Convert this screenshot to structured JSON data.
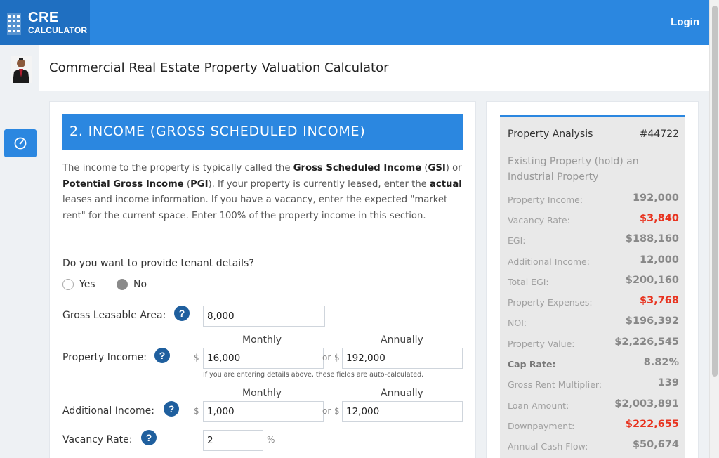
{
  "brand": {
    "line1": "CRE",
    "line2": "CALCULATOR"
  },
  "nav": {
    "login": "Login"
  },
  "page": {
    "title": "Commercial Real Estate Property Valuation Calculator"
  },
  "section": {
    "title": "2. INCOME (GROSS SCHEDULED INCOME)",
    "intro": {
      "p1": "The income to the property is typically called the ",
      "b1": "Gross Scheduled Income",
      "p2": " (",
      "b2": "GSI",
      "p3": ") or ",
      "b3": "Potential Gross Income",
      "p4": " (",
      "b4": "PGI",
      "p5": "). If your property is currently leased, enter the ",
      "b5": "actual",
      "p6": " leases and income information. If you have a vacancy, enter the expected \"market rent\" for the current space. Enter 100% of the property income in this section."
    }
  },
  "tenant": {
    "question": "Do you want to provide tenant details?",
    "yes": "Yes",
    "no": "No",
    "selected": "No"
  },
  "form": {
    "gla": {
      "label": "Gross Leasable Area:",
      "value": "8,000"
    },
    "monthly_header": "Monthly",
    "annually_header": "Annually",
    "currency": "$",
    "or": "or",
    "property_income": {
      "label": "Property Income:",
      "monthly": "16,000",
      "annually": "192,000"
    },
    "note": "If you are entering details above, these fields are auto-calculated.",
    "additional_income": {
      "label": "Additional Income:",
      "monthly": "1,000",
      "annually": "12,000"
    },
    "vacancy": {
      "label": "Vacancy Rate:",
      "value": "2",
      "unit": "%"
    }
  },
  "analysis": {
    "title": "Property Analysis",
    "id": "#44722",
    "description": "Existing Property (hold) an Industrial Property",
    "rows": [
      {
        "label": "Property Income:",
        "value": "192,000"
      },
      {
        "label": "Vacancy Rate:",
        "value": "$3,840"
      },
      {
        "label": "EGI:",
        "value": "$188,160"
      },
      {
        "label": "Additional Income:",
        "value": "12,000"
      },
      {
        "label": "Total EGI:",
        "value": "$200,160"
      },
      {
        "label": "Property Expenses:",
        "value": "$3,768"
      },
      {
        "label": "NOI:",
        "value": "$196,392"
      },
      {
        "label": "Property Value:",
        "value": "$2,226,545"
      },
      {
        "label": "Cap Rate:",
        "value": "8.82%"
      },
      {
        "label": "Gross Rent Multiplier:",
        "value": "139"
      },
      {
        "label": "Loan Amount:",
        "value": "$2,003,891"
      },
      {
        "label": "Downpayment:",
        "value": "$222,655"
      },
      {
        "label": "Annual Cash Flow:",
        "value": "$50,674"
      }
    ]
  },
  "colors": {
    "primary": "#2b87e0",
    "dark_primary": "#1f6fc1",
    "help": "#1f5f9e",
    "negative": "#e8331f"
  },
  "icons": [
    "building-logo-icon",
    "speedometer-icon",
    "help-icon"
  ]
}
